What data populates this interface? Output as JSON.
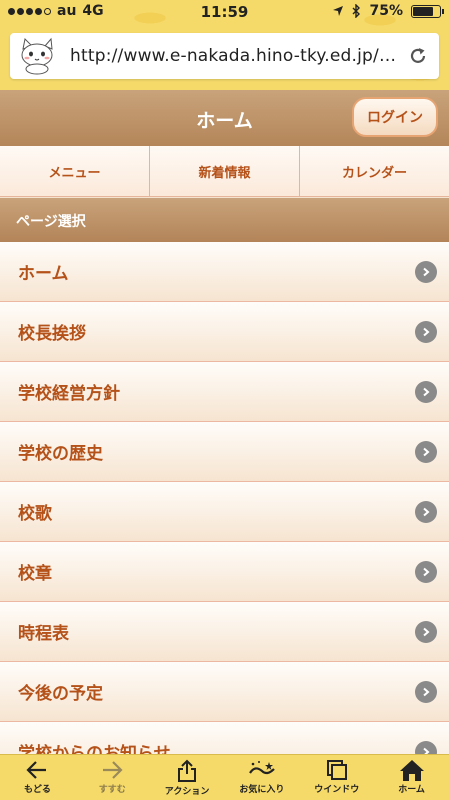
{
  "status_bar": {
    "carrier": "au",
    "network": "4G",
    "time": "11:59",
    "battery": "75%",
    "battery_level": 0.75
  },
  "browser": {
    "url": "http://www.e-nakada.hino-tky.ed.jp/i..."
  },
  "header": {
    "title": "ホーム",
    "login_label": "ログイン"
  },
  "tabs": [
    {
      "label": "メニュー"
    },
    {
      "label": "新着情報"
    },
    {
      "label": "カレンダー"
    }
  ],
  "section": {
    "title": "ページ選択"
  },
  "page_list": [
    {
      "label": "ホーム"
    },
    {
      "label": "校長挨拶"
    },
    {
      "label": "学校経営方針"
    },
    {
      "label": "学校の歴史"
    },
    {
      "label": "校歌"
    },
    {
      "label": "校章"
    },
    {
      "label": "時程表"
    },
    {
      "label": "今後の予定"
    },
    {
      "label": "学校からのお知らせ"
    }
  ],
  "toolbar": {
    "back": "もどる",
    "forward": "すすむ",
    "action": "アクション",
    "favorites": "お気に入り",
    "window": "ウインドウ",
    "home": "ホーム"
  },
  "colors": {
    "accent": "#b5521a",
    "header_bg": "#b48659",
    "toolbar_bg": "#f5da6a"
  }
}
